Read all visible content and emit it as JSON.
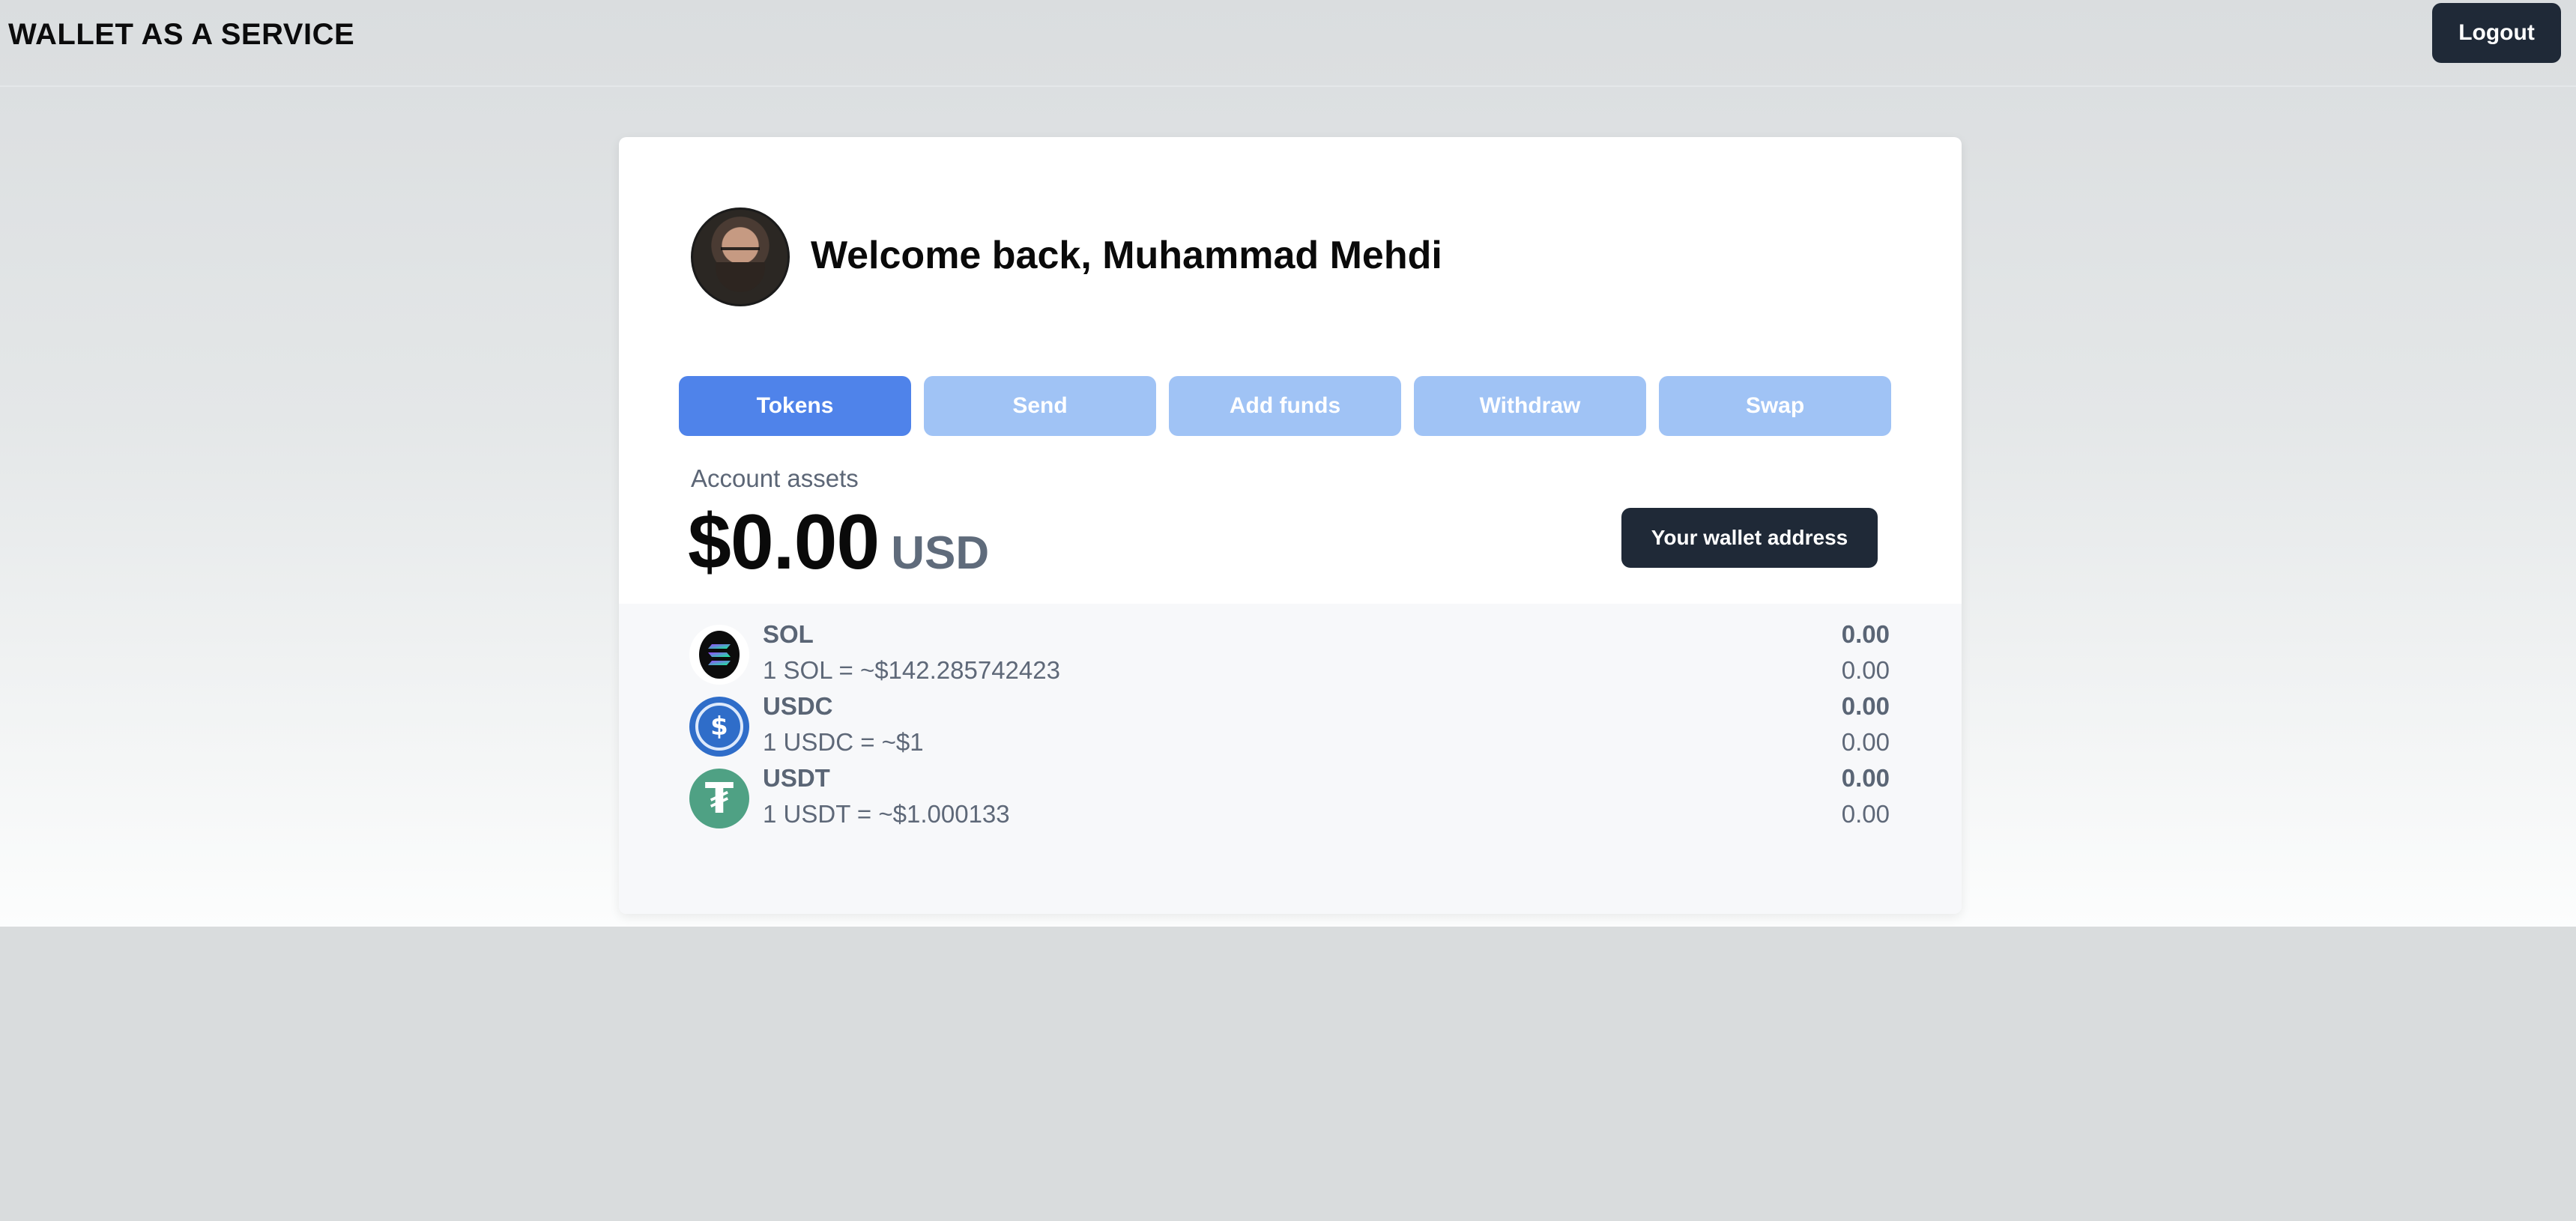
{
  "header": {
    "brand": "WALLET AS A SERVICE",
    "logout_label": "Logout"
  },
  "profile": {
    "welcome_text": "Welcome back, Muhammad Mehdi"
  },
  "tabs": [
    {
      "label": "Tokens",
      "active": true
    },
    {
      "label": "Send",
      "active": false
    },
    {
      "label": "Add funds",
      "active": false
    },
    {
      "label": "Withdraw",
      "active": false
    },
    {
      "label": "Swap",
      "active": false
    }
  ],
  "account": {
    "assets_label": "Account assets",
    "balance": "$0.00",
    "currency": "USD",
    "wallet_button_label": "Your wallet address"
  },
  "tokens": [
    {
      "symbol": "SOL",
      "rate": "1 SOL = ~$142.285742423",
      "balance": "0.00",
      "usd_value": "0.00",
      "icon": "sol-icon"
    },
    {
      "symbol": "USDC",
      "rate": "1 USDC = ~$1",
      "balance": "0.00",
      "usd_value": "0.00",
      "icon": "usdc-icon"
    },
    {
      "symbol": "USDT",
      "rate": "1 USDT = ~$1.000133",
      "balance": "0.00",
      "usd_value": "0.00",
      "icon": "usdt-icon"
    }
  ],
  "colors": {
    "tab_active": "#4f83ea",
    "tab_inactive": "#a0c3f5",
    "dark_button": "#1f2937",
    "usdc_blue": "#2f6dc9",
    "usdt_green": "#4fa184"
  }
}
